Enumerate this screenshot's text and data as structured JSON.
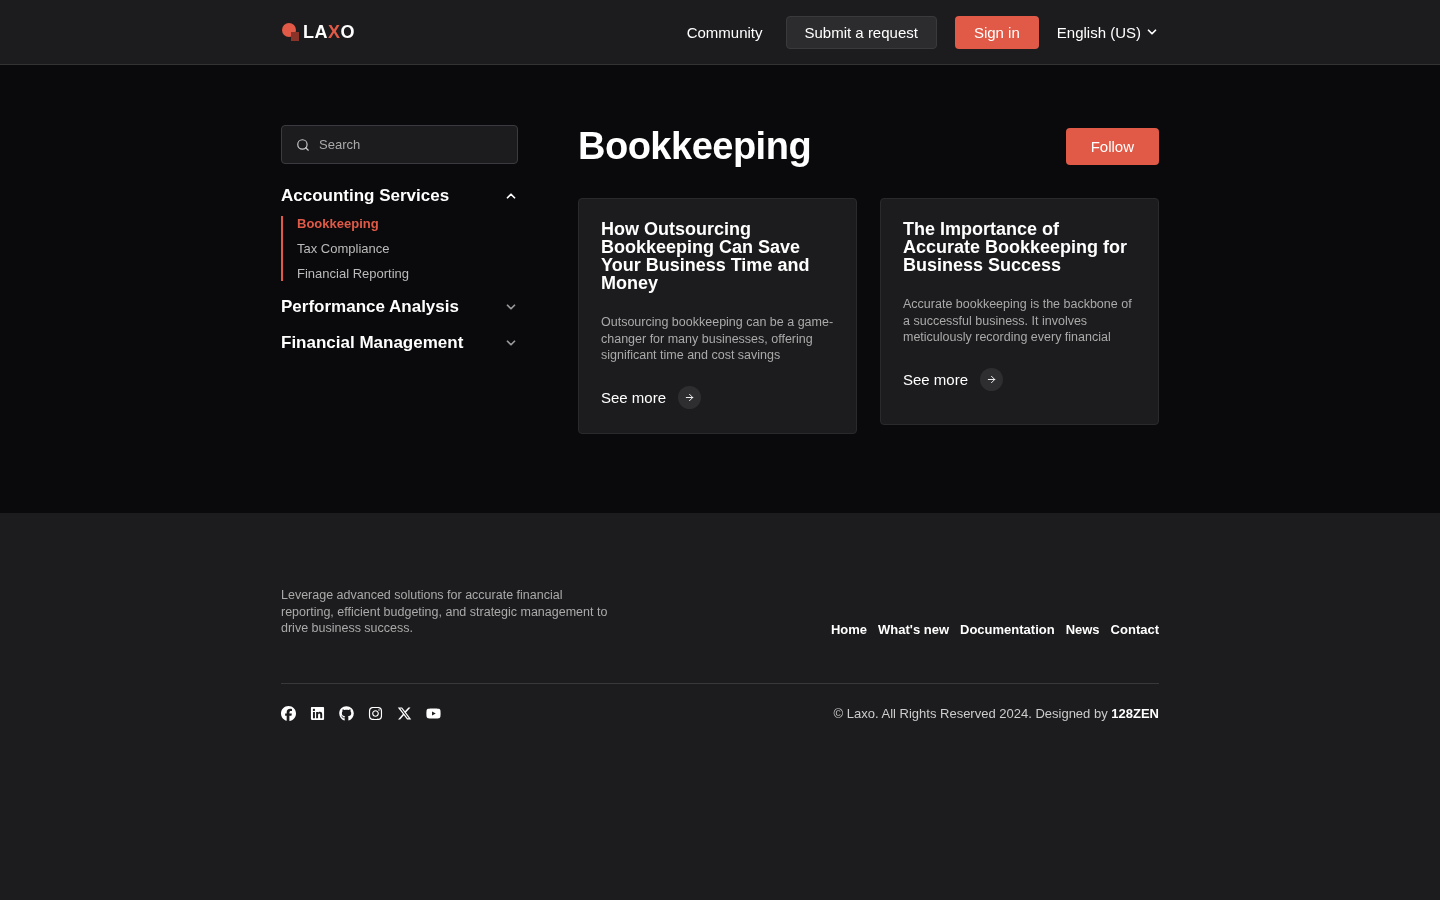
{
  "header": {
    "logo": [
      {
        "text": "LA",
        "accent": false
      },
      {
        "text": "X",
        "accent": true
      },
      {
        "text": "O",
        "accent": false
      }
    ],
    "nav": [
      {
        "label": "Community",
        "kind": "link"
      },
      {
        "label": "Submit a request",
        "kind": "secondary"
      },
      {
        "label": "Sign in",
        "kind": "primary"
      }
    ],
    "language": "English (US)"
  },
  "sidebar": {
    "search": {
      "placeholder": "Search"
    },
    "sections": [
      {
        "title": "Accounting Services",
        "expanded": true,
        "children": [
          {
            "label": "Bookkeeping",
            "selected": true
          },
          {
            "label": "Tax Compliance",
            "selected": false
          },
          {
            "label": "Financial Reporting",
            "selected": false
          }
        ]
      },
      {
        "title": "Performance Analysis",
        "expanded": false
      },
      {
        "title": "Financial Management",
        "expanded": false
      }
    ]
  },
  "main": {
    "title": "Bookkeeping",
    "follow_button": "Follow",
    "articles": [
      {
        "title": "How Outsourcing Bookkeeping Can Save Your Business Time and Money",
        "excerpt": "Outsourcing bookkeeping can be a game-changer for many businesses, offering significant time and cost savings",
        "link": "See more"
      },
      {
        "title": "The Importance of Accurate Bookkeeping for Business Success",
        "excerpt": "Accurate bookkeeping is the backbone of a successful business. It involves meticulously recording every financial",
        "link": "See more"
      }
    ]
  },
  "footer": {
    "tagline": "Leverage advanced solutions for accurate financial reporting, efficient budgeting, and strategic management to drive business success.",
    "links": [
      "Home",
      "What's new",
      "Documentation",
      "News",
      "Contact"
    ],
    "social": [
      {
        "kind": "facebook"
      },
      {
        "kind": "linkedin"
      },
      {
        "kind": "github"
      },
      {
        "kind": "instagram"
      },
      {
        "kind": "x"
      },
      {
        "kind": "youtube"
      }
    ],
    "copyright": "© Laxo. All Rights Reserved 2024. Designed by **128ZEN**"
  }
}
